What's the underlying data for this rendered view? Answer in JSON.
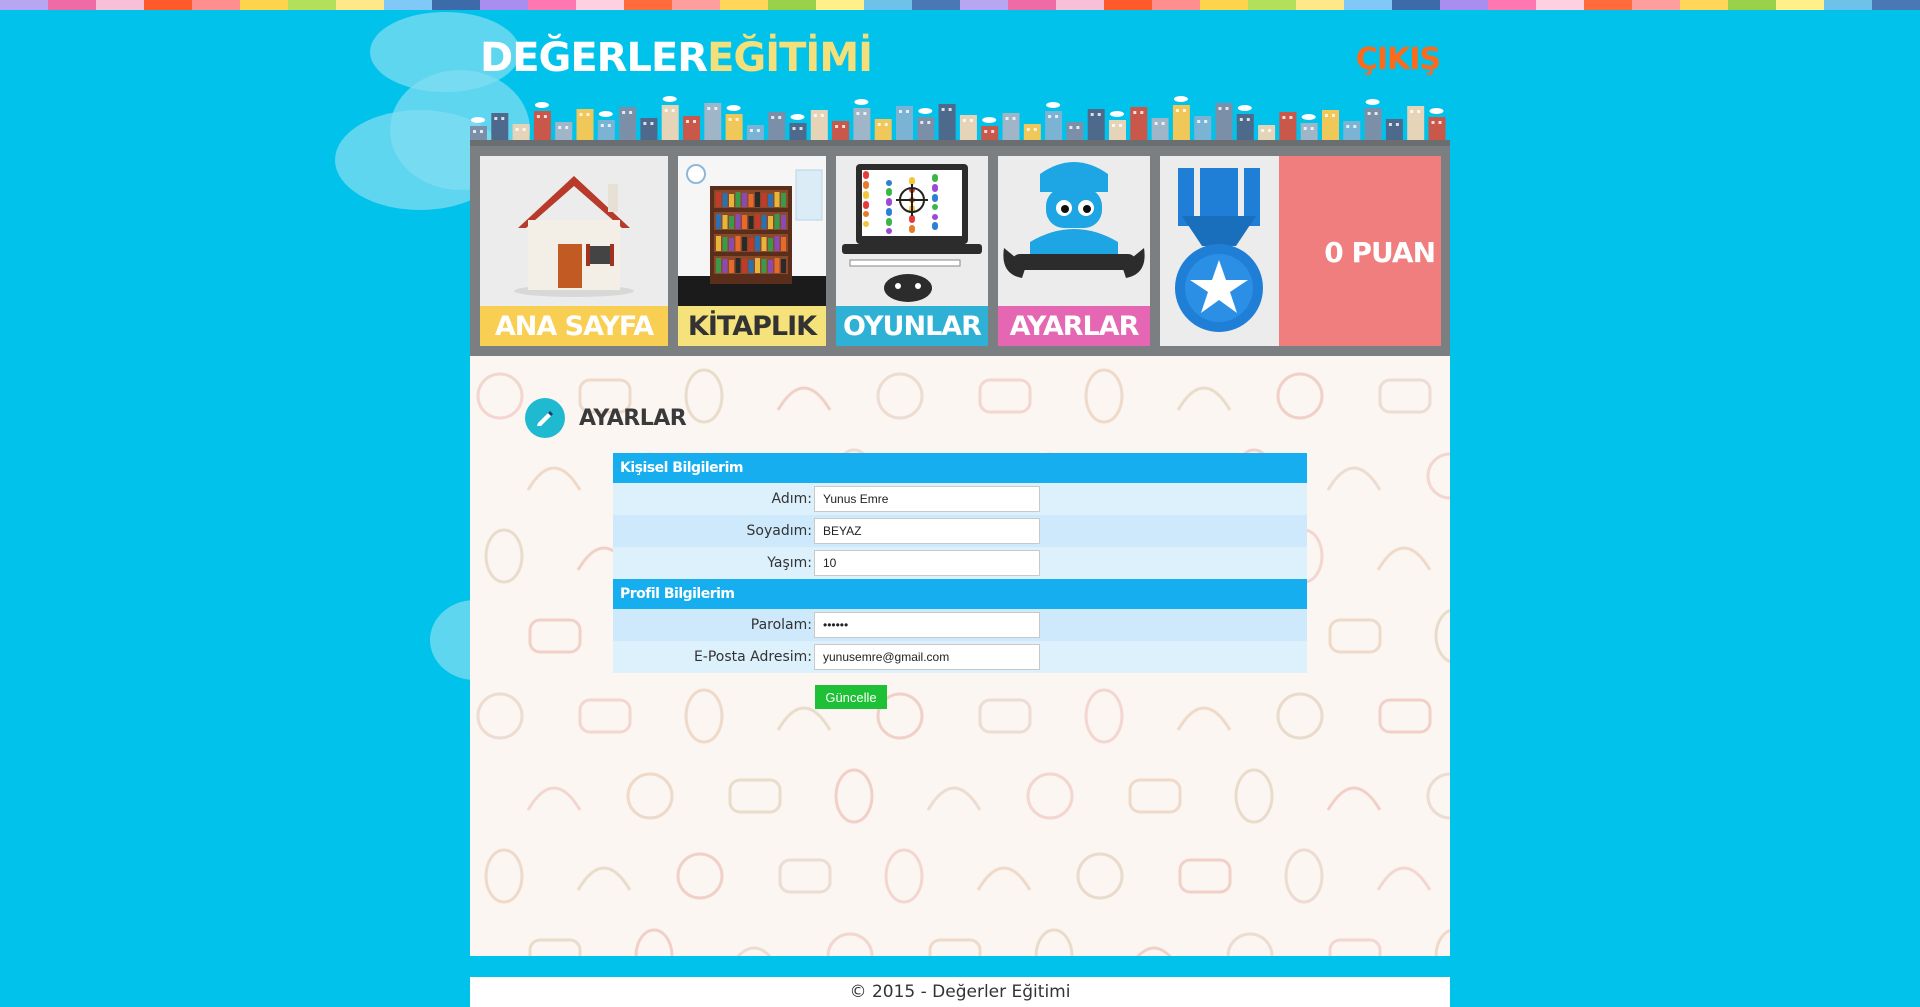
{
  "stripe_colors": [
    "#b8a6f2",
    "#ef6aa6",
    "#f8bfd8",
    "#ff5a2a",
    "#ff8f8f",
    "#ffd44d",
    "#b2e05a",
    "#ffe88a",
    "#7fc8f8",
    "#3d6aa8",
    "#a98ef0",
    "#ff77b0",
    "#ffd0e0",
    "#ff6b3a",
    "#ff9e9e",
    "#ffd55a",
    "#9ad14b",
    "#fff08a",
    "#6ec2ea",
    "#4a78b4"
  ],
  "header": {
    "logo_part1": "DEĞERLER",
    "logo_part2": "EĞİTİMİ",
    "logout_label": "ÇIKIŞ"
  },
  "nav": {
    "items": [
      {
        "label": "ANA SAYFA",
        "color": "#f8cf52"
      },
      {
        "label": "KİTAPLIK",
        "color": "#f6e27a"
      },
      {
        "label": "OYUNLAR",
        "color": "#2fb1d6"
      },
      {
        "label": "AYARLAR",
        "color": "#e566b2"
      }
    ],
    "points": "0 PUAN"
  },
  "section": {
    "title": "AYARLAR"
  },
  "form": {
    "personal_heading": "Kişisel Bilgilerim",
    "profile_heading": "Profil Bilgilerim",
    "fields": [
      {
        "label": "Adım:",
        "value": "Yunus Emre"
      },
      {
        "label": "Soyadım:",
        "value": "BEYAZ"
      },
      {
        "label": "Yaşım:",
        "value": "10"
      },
      {
        "label": "Parolam:",
        "value": "••••••"
      },
      {
        "label": "E-Posta Adresim:",
        "value": "yunusemre@gmail.com"
      }
    ],
    "submit_label": "Güncelle"
  },
  "footer": {
    "text": "© 2015 - Değerler Eğitimi"
  }
}
